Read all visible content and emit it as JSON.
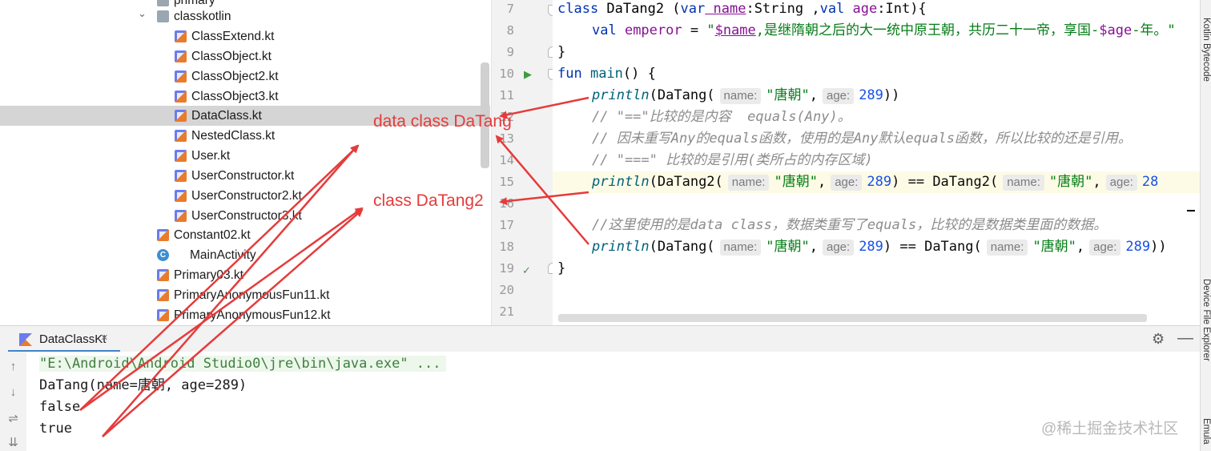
{
  "tree": {
    "items": [
      {
        "label": "primary",
        "icon": "folder-icon",
        "indent": 0
      },
      {
        "label": "classkotlin",
        "icon": "folder-icon",
        "indent": 1,
        "expanded": true
      },
      {
        "label": "ClassExtend.kt",
        "icon": "kotlin-file-icon",
        "indent": 2
      },
      {
        "label": "ClassObject.kt",
        "icon": "kotlin-file-icon",
        "indent": 2
      },
      {
        "label": "ClassObject2.kt",
        "icon": "kotlin-file-icon",
        "indent": 2
      },
      {
        "label": "ClassObject3.kt",
        "icon": "kotlin-file-icon",
        "indent": 2
      },
      {
        "label": "DataClass.kt",
        "icon": "kotlin-file-icon",
        "indent": 2,
        "selected": true
      },
      {
        "label": "NestedClass.kt",
        "icon": "kotlin-file-icon",
        "indent": 2
      },
      {
        "label": "User.kt",
        "icon": "kotlin-file-icon",
        "indent": 2
      },
      {
        "label": "UserConstructor.kt",
        "icon": "kotlin-file-icon",
        "indent": 2
      },
      {
        "label": "UserConstructor2.kt",
        "icon": "kotlin-file-icon",
        "indent": 2
      },
      {
        "label": "UserConstructor3.kt",
        "icon": "kotlin-file-icon",
        "indent": 2
      },
      {
        "label": "Constant02.kt",
        "icon": "kotlin-file-icon",
        "indent": 1
      },
      {
        "label": "MainActivity",
        "icon": "activity-class-icon",
        "indent": 1
      },
      {
        "label": "Primary03.kt",
        "icon": "kotlin-file-icon",
        "indent": 1
      },
      {
        "label": "PrimaryAnonymousFun11.kt",
        "icon": "kotlin-file-icon",
        "indent": 1
      },
      {
        "label": "PrimaryAnonymousFun12.kt",
        "icon": "kotlin-file-icon",
        "indent": 1
      }
    ]
  },
  "editor": {
    "line_numbers": [
      "7",
      "8",
      "9",
      "10",
      "11",
      "12",
      "13",
      "14",
      "15",
      "16",
      "17",
      "18",
      "19",
      "20",
      "21"
    ],
    "code": {
      "l7_class": "class",
      "l7_name": " DaTang2 (",
      "l7_var": "var",
      "l7_p1": " name",
      "l7_t1": ":String ,",
      "l7_val": "val",
      "l7_p2": " age",
      "l7_t2": ":Int){",
      "l8_val": "val",
      "l8_prop": " emperor",
      "l8_eq": " = ",
      "l8_q": "\"",
      "l8_tpl1": "$name",
      "l8_s1": ",是继隋朝之后的大一统中原王朝，共历二十一帝，享国-",
      "l8_tpl2": "$age",
      "l8_s2": "-年。\"",
      "l9": "}",
      "l10_fun": "fun",
      "l10_main": " main",
      "l10_rest": "() {",
      "println": "println",
      "l11_open": "(DaTang(",
      "hint_name": "name:",
      "hint_age": "age:",
      "s_tangchao": "\"唐朝\"",
      "comma": ",",
      "n289": "289",
      "l11_close": "))",
      "l12": "// \"==\"比较的是内容  equals(Any)。",
      "l13": "// 因未重写Any的equals函数，使用的是Any默认equals函数，所以比较的还是引用。",
      "l14": "// \"===\" 比较的是引用(类所占的内存区域)",
      "l15_open": "(DaTang2(",
      "l15_mid": ") == DaTang2(",
      "l15_tail": "28",
      "l17": "//这里使用的是data class，数据类重写了equals，比较的是数据类里面的数据。",
      "l18_open": "(DaTang(",
      "l18_mid": ") == DaTang(",
      "l18_close": "))",
      "l19": "}"
    }
  },
  "right_strip": {
    "tabs": [
      "Kotlin Bytecode",
      "Device File Explorer",
      "Emula"
    ]
  },
  "run_panel": {
    "tab_label": "DataClassKt",
    "close_glyph": "×",
    "settings_glyph": "⚙",
    "minimize_glyph": "—",
    "tools": [
      "↑",
      "↓",
      "⇌",
      "⇊"
    ],
    "output": [
      "\"E:\\Android\\Android Studio0\\jre\\bin\\java.exe\" ...",
      "DaTang(name=唐朝, age=289)",
      "false",
      "true"
    ],
    "watermark": "@稀土掘金技术社区"
  },
  "annotations": {
    "label1": "data class DaTang",
    "label2": "class DaTang2",
    "color": "#e63b3b"
  },
  "colors": {
    "keyword": "#0033b3",
    "string": "#067d17",
    "number": "#1750eb",
    "comment": "#8c8c8c",
    "selection": "#d5d5d5",
    "run_tab_underline": "#4083c9"
  }
}
